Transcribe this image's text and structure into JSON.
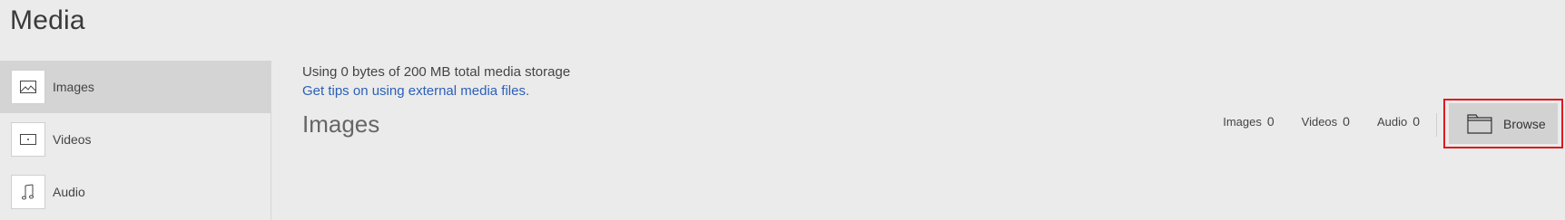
{
  "page": {
    "title": "Media"
  },
  "sidebar": {
    "items": [
      {
        "label": "Images",
        "icon": "image-icon",
        "active": true
      },
      {
        "label": "Videos",
        "icon": "video-icon",
        "active": false
      },
      {
        "label": "Audio",
        "icon": "music-note-icon",
        "active": false
      }
    ]
  },
  "main": {
    "storage_text": "Using 0 bytes of 200 MB total media storage",
    "tips_link": "Get tips on using external media files.",
    "section_title": "Images",
    "counts": [
      {
        "label": "Images",
        "value": "0"
      },
      {
        "label": "Videos",
        "value": "0"
      },
      {
        "label": "Audio",
        "value": "0"
      }
    ],
    "browse_label": "Browse",
    "browse_icon": "folder-icon"
  },
  "colors": {
    "background": "#ebebeb",
    "active_item": "#d4d4d4",
    "link": "#2b5fb8",
    "highlight_outline": "#e0181e"
  }
}
